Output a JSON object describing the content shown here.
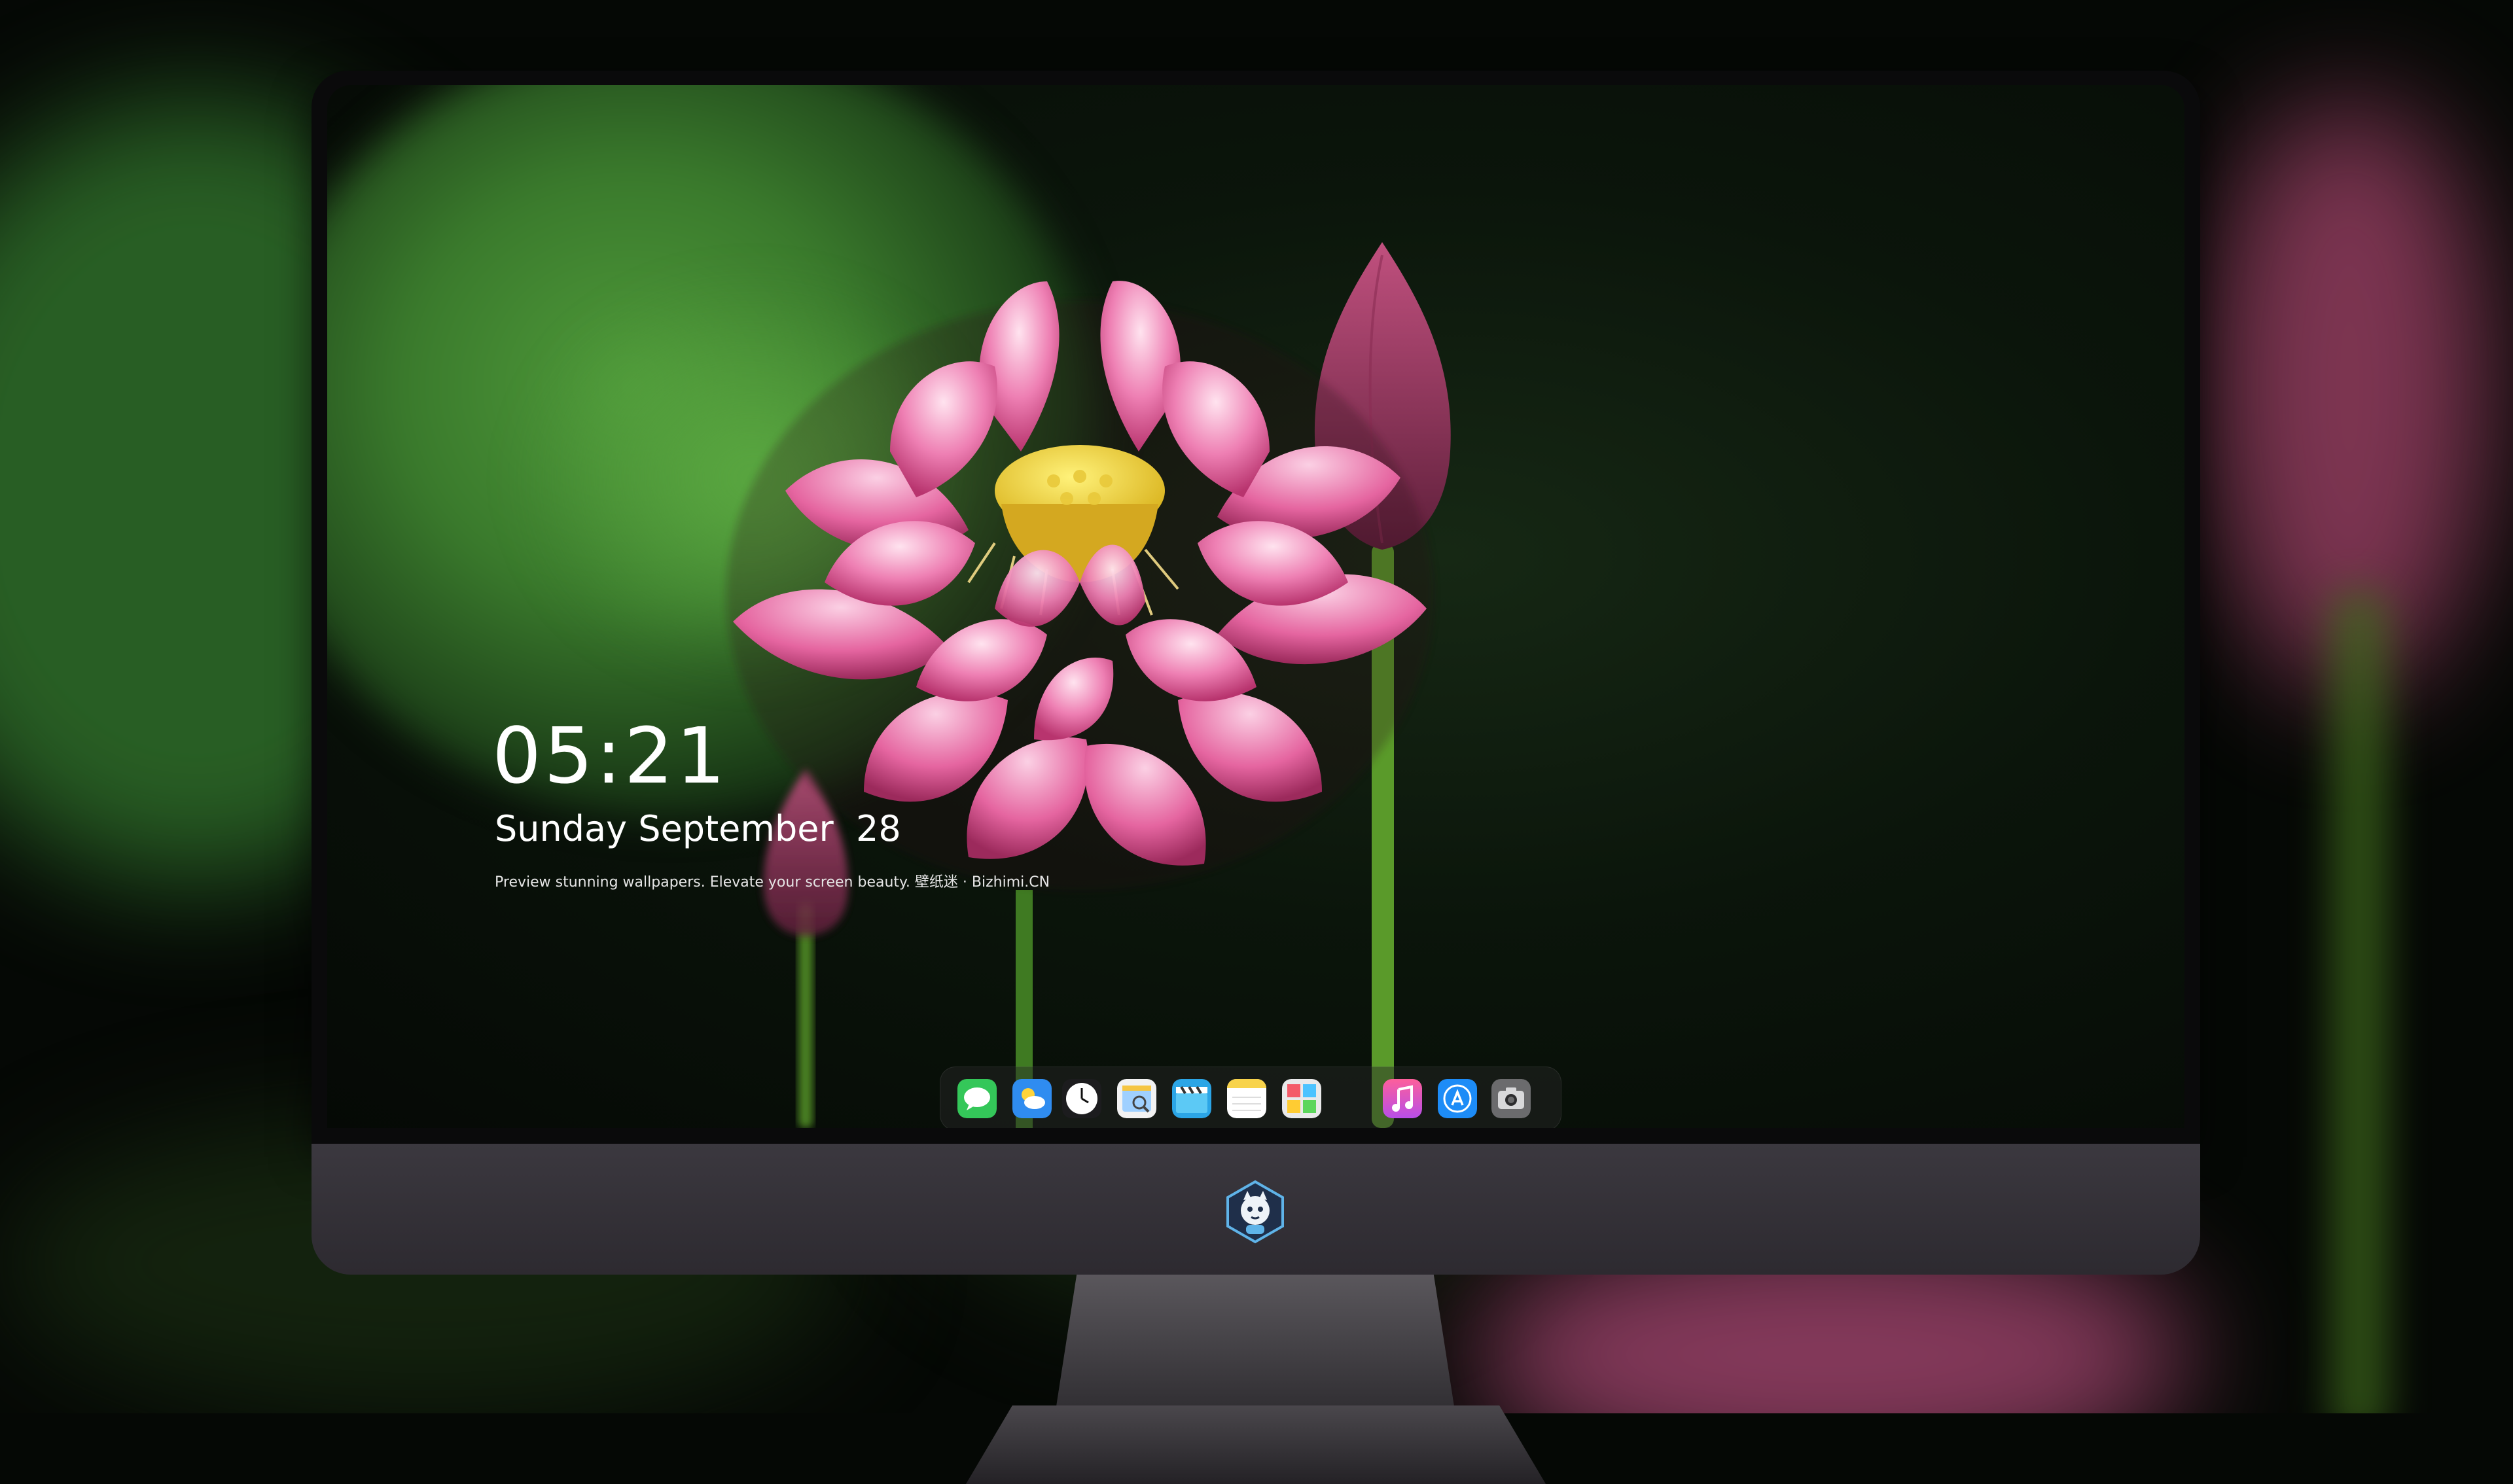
{
  "lock_screen": {
    "time": "05:21",
    "date": "Sunday September  28",
    "tagline": "Preview stunning wallpapers. Elevate your screen beauty. 壁纸迷 · Bizhimi.CN"
  },
  "dock": {
    "apps": [
      "messages",
      "weather",
      "clock",
      "preview",
      "clips",
      "notes",
      "photo-booth",
      "music",
      "app-store",
      "screenshot"
    ]
  },
  "branding": {
    "chin_logo": "mascot-badge"
  },
  "colors": {
    "petal_pink": "#e86aa6",
    "seed_pod_yellow": "#f0d040",
    "stem_green": "#5a9a2a",
    "chin_gray": "#3b383f"
  }
}
